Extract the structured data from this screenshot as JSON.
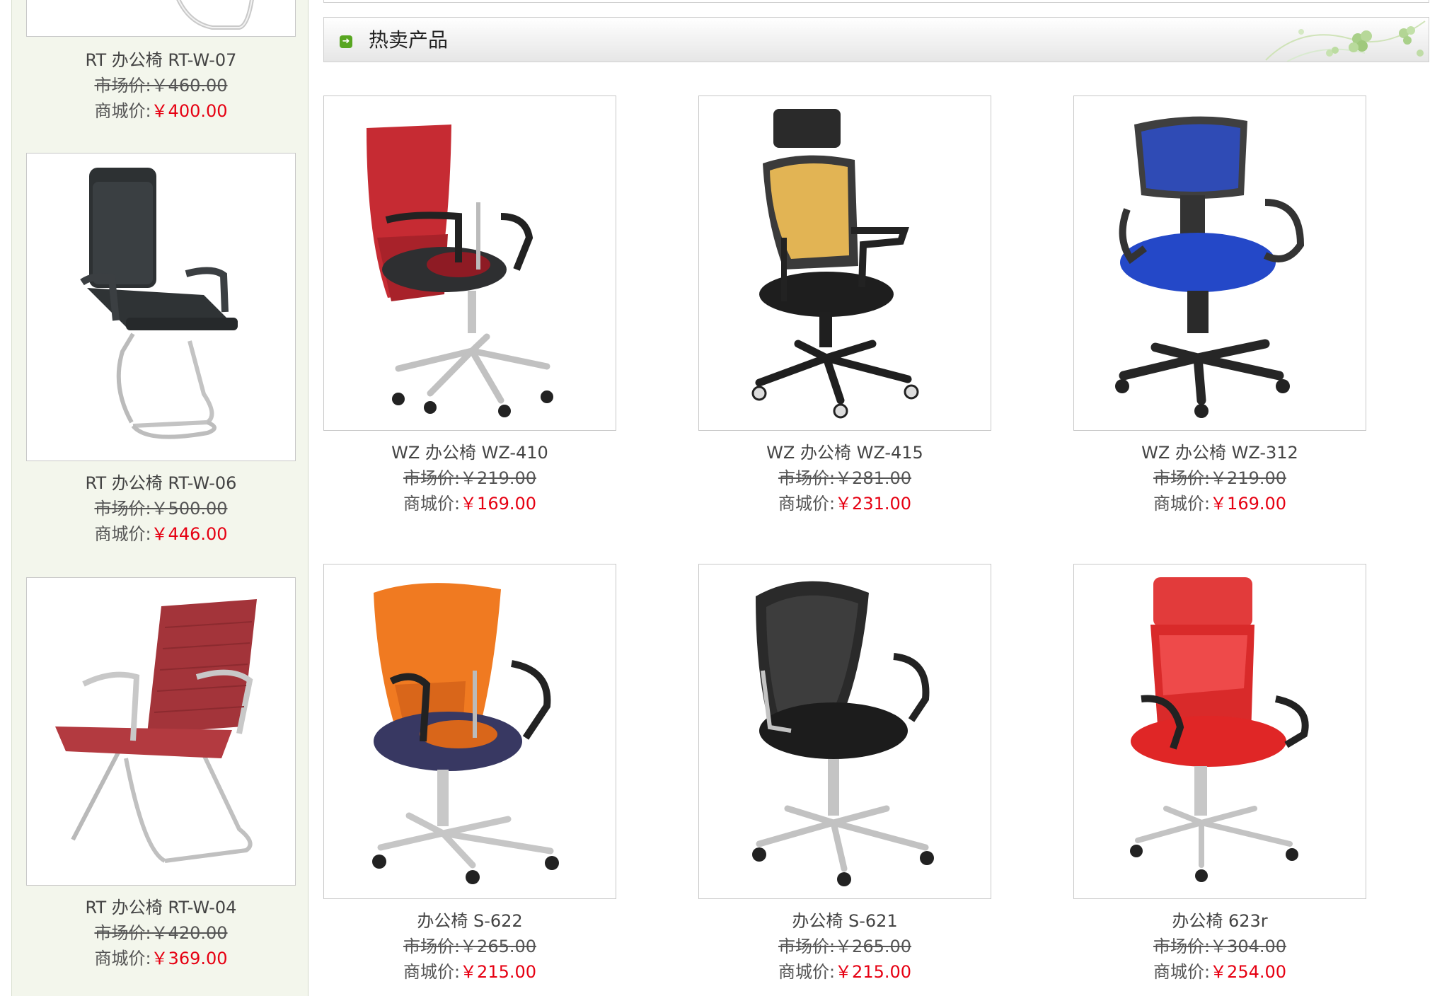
{
  "sidebar": {
    "items": [
      {
        "name": "RT 办公椅 RT-W-07",
        "market_label": "市场价:",
        "market_price": "￥460.00",
        "mall_label": "商城价:",
        "mall_price": "￥400.00"
      },
      {
        "name": "RT 办公椅 RT-W-06",
        "market_label": "市场价:",
        "market_price": "￥500.00",
        "mall_label": "商城价:",
        "mall_price": "￥446.00"
      },
      {
        "name": "RT 办公椅 RT-W-04",
        "market_label": "市场价:",
        "market_price": "￥420.00",
        "mall_label": "商城价:",
        "mall_price": "￥369.00"
      }
    ]
  },
  "section": {
    "title": "热卖产品",
    "icon": "arrow-right-icon"
  },
  "products": [
    {
      "name": "WZ 办公椅 WZ-410",
      "market_label": "市场价:",
      "market_price": "￥219.00",
      "mall_label": "商城价:",
      "mall_price": "￥169.00"
    },
    {
      "name": "WZ 办公椅 WZ-415",
      "market_label": "市场价:",
      "market_price": "￥281.00",
      "mall_label": "商城价:",
      "mall_price": "￥231.00"
    },
    {
      "name": "WZ 办公椅 WZ-312",
      "market_label": "市场价:",
      "market_price": "￥219.00",
      "mall_label": "商城价:",
      "mall_price": "￥169.00"
    },
    {
      "name": "办公椅 S-622",
      "market_label": "市场价:",
      "market_price": "￥265.00",
      "mall_label": "商城价:",
      "mall_price": "￥215.00"
    },
    {
      "name": "办公椅 S-621",
      "market_label": "市场价:",
      "market_price": "￥265.00",
      "mall_label": "商城价:",
      "mall_price": "￥215.00"
    },
    {
      "name": "办公椅 623r",
      "market_label": "市场价:",
      "market_price": "￥304.00",
      "mall_label": "商城价:",
      "mall_price": "￥254.00"
    }
  ],
  "colors": {
    "price_red": "#e60012",
    "sidebar_bg": "#f3f6ec",
    "accent_green": "#58a621"
  }
}
